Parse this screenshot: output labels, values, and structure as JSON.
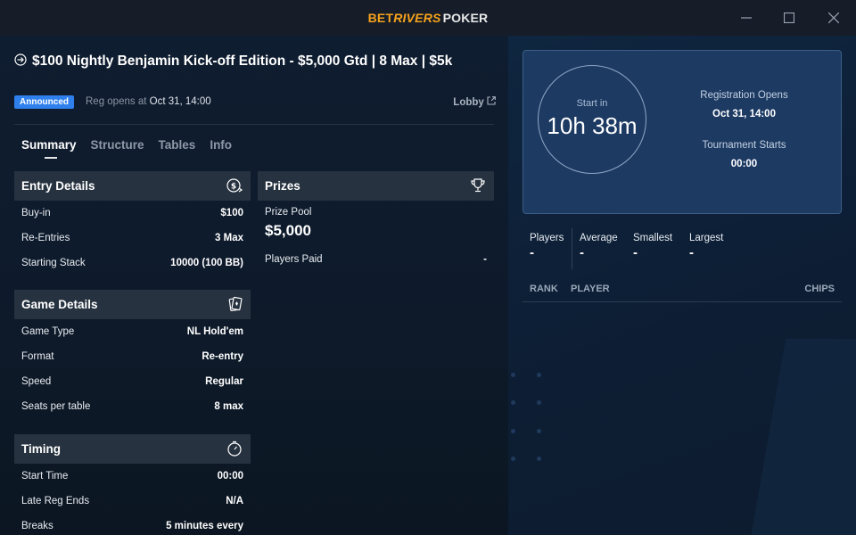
{
  "window": {
    "brand": {
      "part1": "BET",
      "part2": "RIVERS",
      "part3": "POKER"
    },
    "controls": {
      "minimize": "—",
      "maximize": "☐",
      "close": "✕"
    }
  },
  "tournament": {
    "title": "$100 Nightly Benjamin Kick-off Edition - $5,000 Gtd | 8 Max | $5k",
    "status_badge": "Announced",
    "reg_label": "Reg opens at",
    "reg_value": "Oct 31, 14:00",
    "lobby_link": "Lobby"
  },
  "tabs": [
    {
      "label": "Summary",
      "active": true
    },
    {
      "label": "Structure",
      "active": false
    },
    {
      "label": "Tables",
      "active": false
    },
    {
      "label": "Info",
      "active": false
    }
  ],
  "entry_details": {
    "heading": "Entry Details",
    "icon": "dollar-exchange-icon",
    "rows": [
      {
        "label": "Buy-in",
        "value": "$100"
      },
      {
        "label": "Re-Entries",
        "value": "3 Max"
      },
      {
        "label": "Starting Stack",
        "value": "10000 (100 BB)"
      }
    ]
  },
  "prizes": {
    "heading": "Prizes",
    "icon": "trophy-icon",
    "pool_label": "Prize Pool",
    "pool_value": "$5,000",
    "paid_label": "Players Paid",
    "paid_value": "-"
  },
  "game_details": {
    "heading": "Game Details",
    "icon": "cards-icon",
    "rows": [
      {
        "label": "Game Type",
        "value": "NL Hold'em"
      },
      {
        "label": "Format",
        "value": "Re-entry"
      },
      {
        "label": "Speed",
        "value": "Regular"
      },
      {
        "label": "Seats per table",
        "value": "8 max"
      }
    ]
  },
  "timing": {
    "heading": "Timing",
    "icon": "stopwatch-icon",
    "rows": [
      {
        "label": "Start Time",
        "value": "00:00"
      },
      {
        "label": "Late Reg Ends",
        "value": "N/A"
      },
      {
        "label": "Breaks",
        "value": "5 minutes every"
      }
    ]
  },
  "countdown": {
    "label": "Start in",
    "time": "10h 38m",
    "reg_opens_label": "Registration Opens",
    "reg_opens_value": "Oct 31, 14:00",
    "starts_label": "Tournament Starts",
    "starts_value": "00:00"
  },
  "stats": [
    {
      "label": "Players",
      "value": "-"
    },
    {
      "label": "Average",
      "value": "-"
    },
    {
      "label": "Smallest",
      "value": "-"
    },
    {
      "label": "Largest",
      "value": "-"
    }
  ],
  "leaderboard": {
    "columns": [
      "RANK",
      "PLAYER",
      "CHIPS"
    ]
  }
}
